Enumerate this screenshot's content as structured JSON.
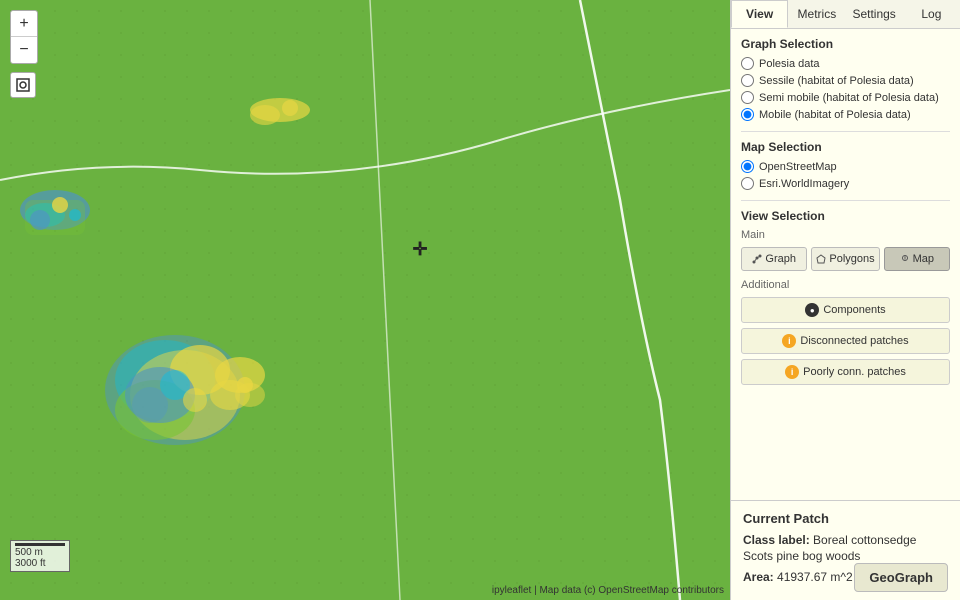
{
  "tabs": [
    {
      "label": "View",
      "active": true
    },
    {
      "label": "Metrics",
      "active": false
    },
    {
      "label": "Settings",
      "active": false
    },
    {
      "label": "Log",
      "active": false
    }
  ],
  "graph_selection": {
    "title": "Graph Selection",
    "options": [
      {
        "label": "Polesia data",
        "selected": false
      },
      {
        "label": "Sessile (habitat of Polesia data)",
        "selected": false
      },
      {
        "label": "Semi mobile (habitat of Polesia data)",
        "selected": false
      },
      {
        "label": "Mobile (habitat of Polesia data)",
        "selected": true
      }
    ]
  },
  "map_selection": {
    "title": "Map Selection",
    "options": [
      {
        "label": "OpenStreetMap",
        "selected": true
      },
      {
        "label": "Esri.WorldImagery",
        "selected": false
      }
    ]
  },
  "view_selection": {
    "title": "View Selection",
    "main_label": "Main",
    "buttons": [
      {
        "label": "Graph",
        "icon": "graph",
        "active": false
      },
      {
        "label": "Polygons",
        "icon": "polygon",
        "active": false
      },
      {
        "label": "Map",
        "icon": "map",
        "active": true
      }
    ],
    "additional_label": "Additional",
    "additional_buttons": [
      {
        "label": "Components",
        "icon": "dot"
      },
      {
        "label": "Disconnected patches",
        "icon": "info"
      },
      {
        "label": "Poorly conn. patches",
        "icon": "info"
      }
    ]
  },
  "current_patch": {
    "title": "Current Patch",
    "class_label_prefix": "Class label:",
    "class_label_value": "Boreal cottonsedge Scots pine bog woods",
    "area_prefix": "Area:",
    "area_value": "41937.67 m^2"
  },
  "zoom": {
    "plus": "+",
    "minus": "−",
    "extent_icon": "⊙"
  },
  "scale": {
    "top": "500 m",
    "bottom": "3000 ft"
  },
  "attribution": "ipyleaflet | Map data (c) OpenStreetMap contributors",
  "attribution_link": "OpenStreetMap",
  "geograph_btn": "GeoGraph"
}
